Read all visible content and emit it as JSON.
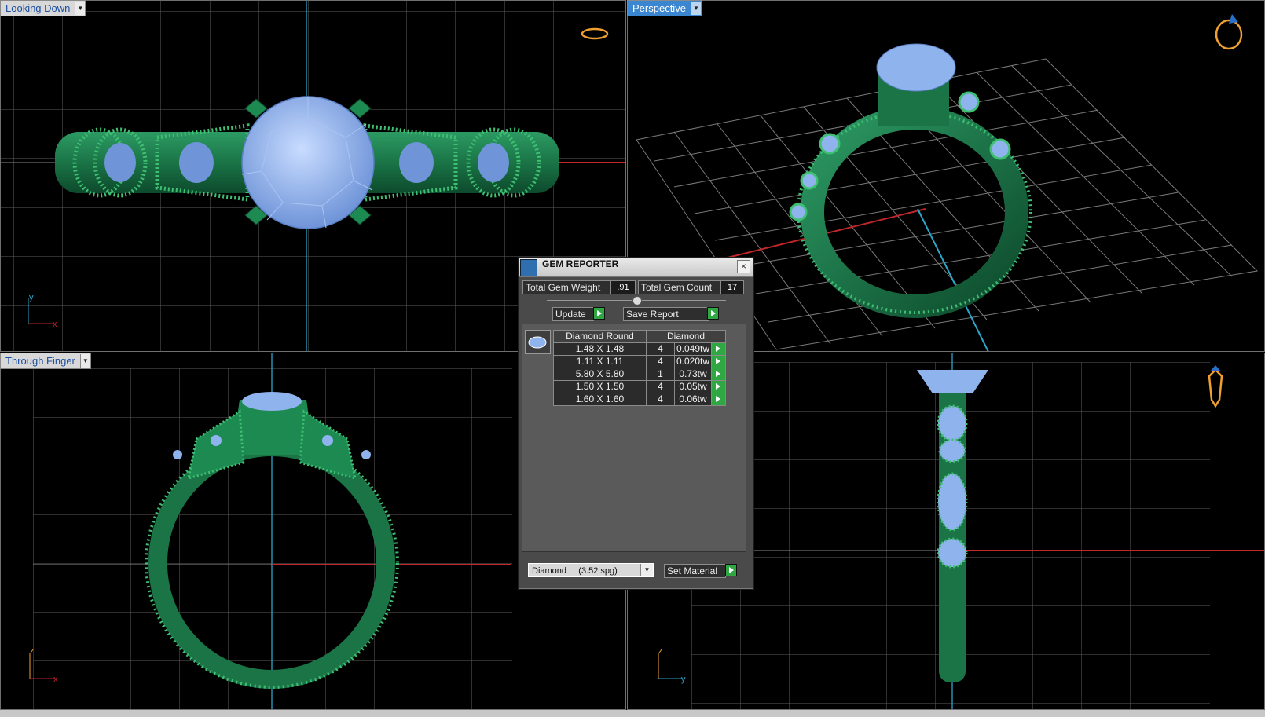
{
  "viewports": {
    "top_left": {
      "label": "Looking Down",
      "axis_y": "y",
      "axis_x": "x"
    },
    "top_right": {
      "label": "Perspective"
    },
    "bottom_left": {
      "label": "Through Finger",
      "axis_y": "z",
      "axis_x": "x"
    },
    "bottom_right": {
      "axis_y": "z",
      "axis_x": "y"
    }
  },
  "gem_reporter": {
    "title": "GEM REPORTER",
    "total_weight_label": "Total Gem Weight",
    "total_weight_value": ".91",
    "total_count_label": "Total Gem Count",
    "total_count_value": "17",
    "update_label": "Update",
    "save_report_label": "Save Report",
    "table_headers": [
      "Diamond Round",
      "Diamond"
    ],
    "rows": [
      {
        "size": "1.48 X 1.48",
        "count": "4",
        "weight": "0.049tw"
      },
      {
        "size": "1.11 X 1.11",
        "count": "4",
        "weight": "0.020tw"
      },
      {
        "size": "5.80 X 5.80",
        "count": "1",
        "weight": "0.73tw"
      },
      {
        "size": "1.50 X 1.50",
        "count": "4",
        "weight": "0.05tw"
      },
      {
        "size": "1.60 X 1.60",
        "count": "4",
        "weight": "0.06tw"
      }
    ],
    "material_select": "Diamond     (3.52 spg)",
    "set_material_label": "Set Material"
  },
  "colors": {
    "metal": "#1f7f4f",
    "gem": "#8fb3ec",
    "grid": "#6a6a6a",
    "axis_red": "#c0262a",
    "axis_cyan": "#2aa6c8"
  }
}
